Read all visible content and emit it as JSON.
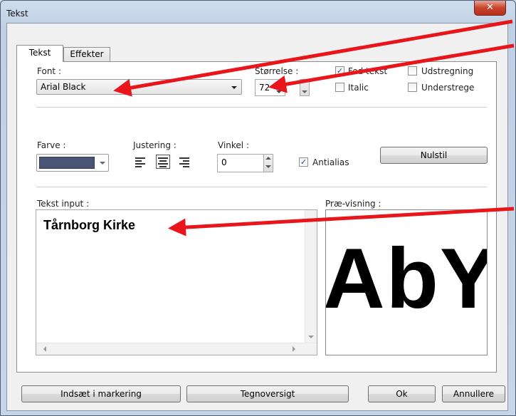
{
  "window": {
    "title": "Tekst",
    "close_glyph": "✕"
  },
  "tabs": [
    {
      "label": "Tekst",
      "active": true
    },
    {
      "label": "Effekter",
      "active": false
    }
  ],
  "font": {
    "label": "Font :",
    "value": "Arial Black"
  },
  "size": {
    "label": "Størrelse :",
    "value": "72"
  },
  "style_options": {
    "bold": {
      "label": "Fed tekst",
      "checked": true
    },
    "italic": {
      "label": "Italic",
      "checked": false
    },
    "strikethrough": {
      "label": "Udstregning",
      "checked": false
    },
    "underline": {
      "label": "Understrege",
      "checked": false
    }
  },
  "color": {
    "label": "Farve :",
    "swatch": "#4a5574"
  },
  "alignment": {
    "label": "Justering :",
    "selected": "center"
  },
  "angle": {
    "label": "Vinkel :",
    "value": "0"
  },
  "antialias": {
    "label": "Antialias",
    "checked": true
  },
  "reset_label": "Nulstil",
  "text_input": {
    "label": "Tekst input :",
    "value": "Tårnborg Kirke"
  },
  "preview": {
    "label": "Præ-visning :",
    "sample": "AbY:"
  },
  "footer": {
    "insert_label": "Indsæt i markering",
    "charmap_label": "Tegnoversigt",
    "ok_label": "Ok",
    "cancel_label": "Annullere"
  },
  "annotation_color": "#e8151b",
  "check_glyph": "✓"
}
